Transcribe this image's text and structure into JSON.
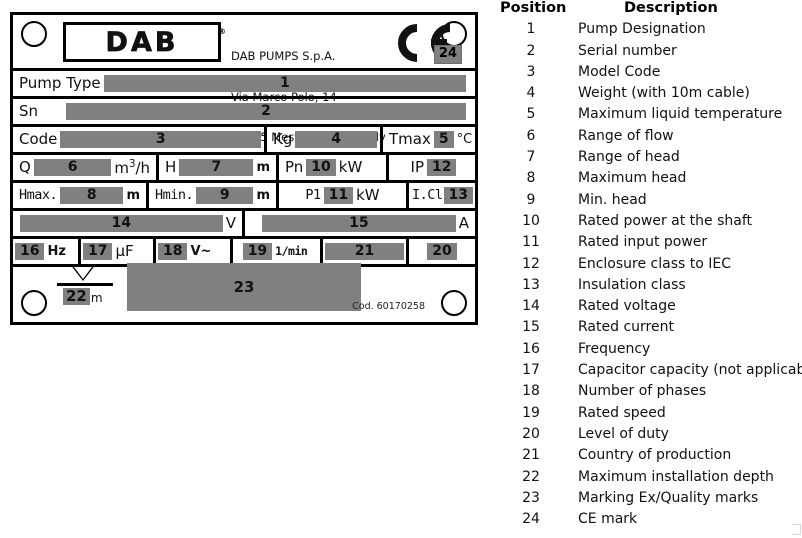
{
  "nameplate": {
    "brand": "DAB",
    "registered_mark": "®",
    "company": {
      "line1": "DAB PUMPS S.p.A.",
      "line2": "Via Marco Polo, 14",
      "line3": "35035 Mestrino (PD) - Italy"
    },
    "ce_mark_icon": "ce-mark-icon",
    "ce_badge": "24",
    "rows": {
      "pump_type_label": "Pump Type",
      "pump_type_value": "1",
      "sn_label": "Sn",
      "sn_value": "2",
      "code_label": "Code",
      "code_value": "3",
      "kg_label": "Kg",
      "kg_value": "4",
      "tmax_label": "Tmax",
      "tmax_value": "5",
      "tmax_unit": "°C",
      "q_label": "Q",
      "q_value": "6",
      "q_unit": "m3/h",
      "h_label": "H",
      "h_value": "7",
      "h_unit": "m",
      "pn_label": "Pn",
      "pn_value": "10",
      "pn_unit": "kW",
      "ip_label": "IP",
      "ip_value": "12",
      "hmax_label": "Hmax.",
      "hmax_value": "8",
      "hmax_unit": "m",
      "hmin_label": "Hmin.",
      "hmin_value": "9",
      "hmin_unit": "m",
      "p1_label": "P1",
      "p1_value": "11",
      "p1_unit": "kW",
      "icl_label": "I.Cl",
      "icl_value": "13",
      "voltage_value": "14",
      "voltage_unit": "V",
      "current_value": "15",
      "current_unit": "A",
      "freq_value": "16",
      "freq_unit": "Hz",
      "cap_value": "17",
      "cap_unit": "µF",
      "phases_value": "18",
      "phases_unit": "V~",
      "speed_value": "19",
      "speed_unit": "1/min",
      "country_value": "21",
      "duty_value": "20",
      "depth_value": "22",
      "depth_unit": "m",
      "marking_value": "23"
    },
    "cod": "Cod. 60170258",
    "hole_icon": "mounting-hole-icon"
  },
  "table": {
    "header": {
      "position": "Position",
      "description": "Description"
    },
    "rows": [
      {
        "position": "1",
        "description": "Pump Designation"
      },
      {
        "position": "2",
        "description": "Serial number"
      },
      {
        "position": "3",
        "description": "Model Code"
      },
      {
        "position": "4",
        "description": "Weight (with 10m cable)"
      },
      {
        "position": "5",
        "description": "Maximum liquid temperature"
      },
      {
        "position": "6",
        "description": "Range of flow"
      },
      {
        "position": "7",
        "description": "Range of head"
      },
      {
        "position": "8",
        "description": "Maximum head"
      },
      {
        "position": "9",
        "description": "Min. head"
      },
      {
        "position": "10",
        "description": "Rated power at the shaft"
      },
      {
        "position": "11",
        "description": "Rated input power"
      },
      {
        "position": "12",
        "description": "Enclosure class to IEC"
      },
      {
        "position": "13",
        "description": "Insulation class"
      },
      {
        "position": "14",
        "description": "Rated voltage"
      },
      {
        "position": "15",
        "description": "Rated current"
      },
      {
        "position": "16",
        "description": "Frequency"
      },
      {
        "position": "17",
        "description": "Capacitor capacity (not applicable)"
      },
      {
        "position": "18",
        "description": "Number of phases"
      },
      {
        "position": "19",
        "description": "Rated speed"
      },
      {
        "position": "20",
        "description": "Level of duty"
      },
      {
        "position": "21",
        "description": "Country of production"
      },
      {
        "position": "22",
        "description": "Maximum installation depth"
      },
      {
        "position": "23",
        "description": "Marking Ex/Quality marks"
      },
      {
        "position": "24",
        "description": "CE mark"
      }
    ]
  },
  "colors": {
    "field_gray": "#808080",
    "border_black": "#000000",
    "text_black": "#111111"
  }
}
